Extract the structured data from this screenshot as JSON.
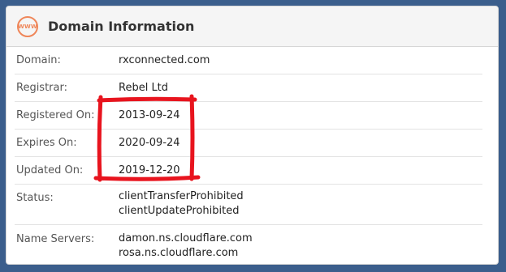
{
  "panel": {
    "title": "Domain Information",
    "icon_text": "WWW",
    "icon": "www-globe-icon"
  },
  "fields": {
    "domain": {
      "label": "Domain:",
      "value": "rxconnected.com"
    },
    "registrar": {
      "label": "Registrar:",
      "value": "Rebel Ltd"
    },
    "registered_on": {
      "label": "Registered On:",
      "value": "2013-09-24"
    },
    "expires_on": {
      "label": "Expires On:",
      "value": "2020-09-24"
    },
    "updated_on": {
      "label": "Updated On:",
      "value": "2019-12-20"
    },
    "status": {
      "label": "Status:",
      "values": [
        "clientTransferProhibited",
        "clientUpdateProhibited"
      ]
    },
    "name_servers": {
      "label": "Name Servers:",
      "values": [
        "damon.ns.cloudflare.com",
        "rosa.ns.cloudflare.com"
      ]
    }
  },
  "colors": {
    "background": "#3b5e8c",
    "icon_accent": "#ef8659",
    "highlight_marker": "#e8141e"
  }
}
